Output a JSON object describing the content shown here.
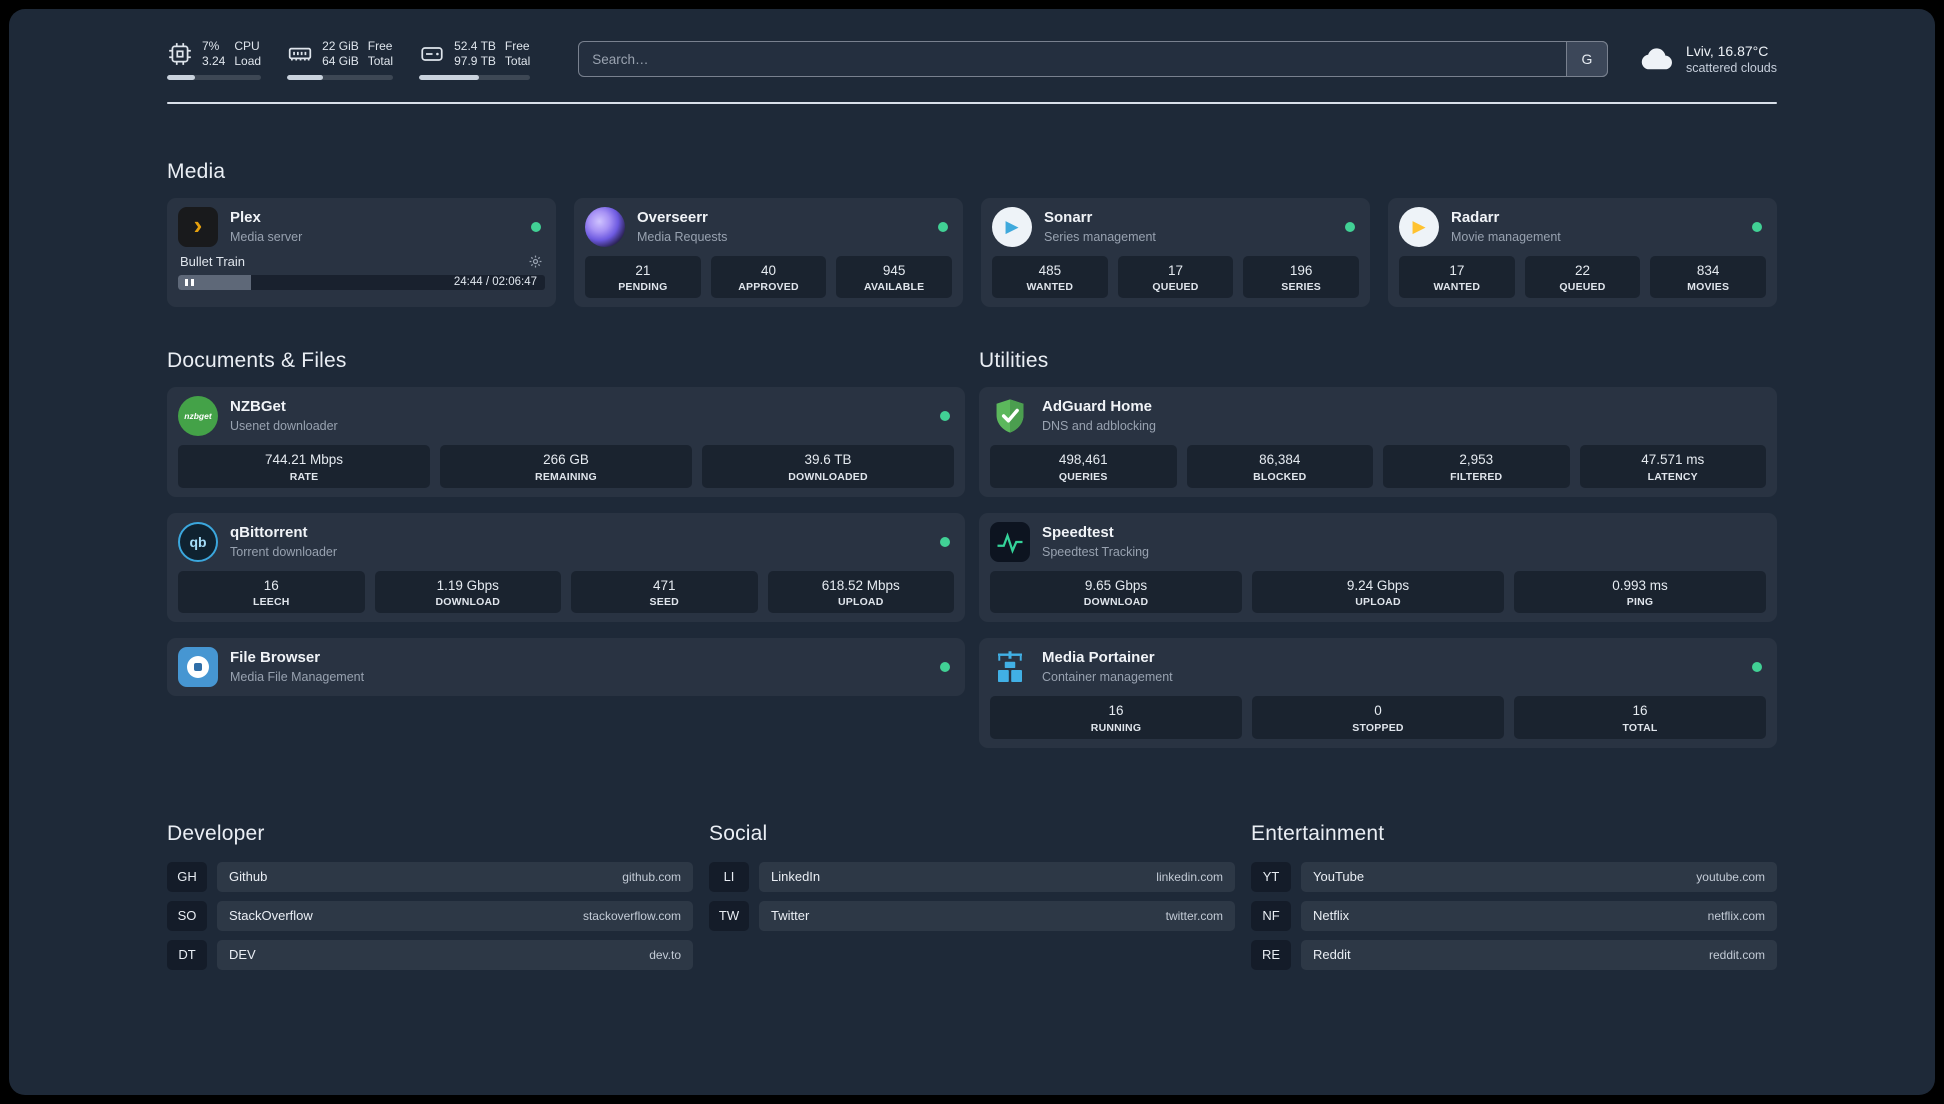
{
  "topbar": {
    "resources": [
      {
        "id": "cpu",
        "value_top": "7%",
        "value_bottom": "3.24",
        "label_top": "CPU",
        "label_bottom": "Load",
        "progress": 30
      },
      {
        "id": "memory",
        "value_top": "22 GiB",
        "value_bottom": "64 GiB",
        "label_top": "Free",
        "label_bottom": "Total",
        "progress": 34
      },
      {
        "id": "disk",
        "value_top": "52.4 TB",
        "value_bottom": "97.9 TB",
        "label_top": "Free",
        "label_bottom": "Total",
        "progress": 54
      }
    ],
    "search": {
      "placeholder": "Search…",
      "provider_label": "G"
    },
    "weather": {
      "location": "Lviv, 16.87°C",
      "condition": "scattered clouds"
    }
  },
  "sections": {
    "media": "Media",
    "documents": "Documents & Files",
    "utilities": "Utilities"
  },
  "icons": {
    "plex_glyph": "›",
    "sonarr_glyph": "▶",
    "radarr_glyph": "▶",
    "nzbget_text": "nzbget",
    "qbittorrent_text": "qb"
  },
  "colors": {
    "status_online": "#41d195",
    "plex": "#e5a00d",
    "overseerr": "#6d5ae0",
    "sonarr": "#3fa9dc",
    "radarr": "#ffc230",
    "nzbget": "#44a248",
    "qbittorrent": "#3ba7dd",
    "filebrowser": "#4696d2",
    "adguard": "#5cb85c",
    "speedtest": "#34d399",
    "portainer": "#41b0e5"
  },
  "services": {
    "plex": {
      "name": "Plex",
      "description": "Media server",
      "status": "online",
      "player": {
        "title": "Bullet Train",
        "time": "24:44 / 02:06:47",
        "progress": 20
      }
    },
    "overseerr": {
      "name": "Overseerr",
      "description": "Media Requests",
      "status": "online",
      "stats": [
        {
          "value": "21",
          "label": "PENDING"
        },
        {
          "value": "40",
          "label": "APPROVED"
        },
        {
          "value": "945",
          "label": "AVAILABLE"
        }
      ]
    },
    "sonarr": {
      "name": "Sonarr",
      "description": "Series management",
      "status": "online",
      "stats": [
        {
          "value": "485",
          "label": "WANTED"
        },
        {
          "value": "17",
          "label": "QUEUED"
        },
        {
          "value": "196",
          "label": "SERIES"
        }
      ]
    },
    "radarr": {
      "name": "Radarr",
      "description": "Movie management",
      "status": "online",
      "stats": [
        {
          "value": "17",
          "label": "WANTED"
        },
        {
          "value": "22",
          "label": "QUEUED"
        },
        {
          "value": "834",
          "label": "MOVIES"
        }
      ]
    },
    "nzbget": {
      "name": "NZBGet",
      "description": "Usenet downloader",
      "status": "online",
      "stats": [
        {
          "value": "744.21 Mbps",
          "label": "RATE"
        },
        {
          "value": "266 GB",
          "label": "REMAINING"
        },
        {
          "value": "39.6 TB",
          "label": "DOWNLOADED"
        }
      ]
    },
    "qbittorrent": {
      "name": "qBittorrent",
      "description": "Torrent downloader",
      "status": "online",
      "stats": [
        {
          "value": "16",
          "label": "LEECH"
        },
        {
          "value": "1.19 Gbps",
          "label": "DOWNLOAD"
        },
        {
          "value": "471",
          "label": "SEED"
        },
        {
          "value": "618.52 Mbps",
          "label": "UPLOAD"
        }
      ]
    },
    "filebrowser": {
      "name": "File Browser",
      "description": "Media File Management",
      "status": "online"
    },
    "adguard": {
      "name": "AdGuard Home",
      "description": "DNS and adblocking",
      "stats": [
        {
          "value": "498,461",
          "label": "QUERIES"
        },
        {
          "value": "86,384",
          "label": "BLOCKED"
        },
        {
          "value": "2,953",
          "label": "FILTERED"
        },
        {
          "value": "47.571 ms",
          "label": "LATENCY"
        }
      ]
    },
    "speedtest": {
      "name": "Speedtest",
      "description": "Speedtest Tracking",
      "stats": [
        {
          "value": "9.65 Gbps",
          "label": "DOWNLOAD"
        },
        {
          "value": "9.24 Gbps",
          "label": "UPLOAD"
        },
        {
          "value": "0.993 ms",
          "label": "PING"
        }
      ]
    },
    "portainer": {
      "name": "Media Portainer",
      "description": "Container management",
      "status": "online",
      "stats": [
        {
          "value": "16",
          "label": "RUNNING"
        },
        {
          "value": "0",
          "label": "STOPPED"
        },
        {
          "value": "16",
          "label": "TOTAL"
        }
      ]
    }
  },
  "bookmarks": {
    "developer": {
      "title": "Developer",
      "items": [
        {
          "abbr": "GH",
          "name": "Github",
          "domain": "github.com"
        },
        {
          "abbr": "SO",
          "name": "StackOverflow",
          "domain": "stackoverflow.com"
        },
        {
          "abbr": "DT",
          "name": "DEV",
          "domain": "dev.to"
        }
      ]
    },
    "social": {
      "title": "Social",
      "items": [
        {
          "abbr": "LI",
          "name": "LinkedIn",
          "domain": "linkedin.com"
        },
        {
          "abbr": "TW",
          "name": "Twitter",
          "domain": "twitter.com"
        }
      ]
    },
    "entertainment": {
      "title": "Entertainment",
      "items": [
        {
          "abbr": "YT",
          "name": "YouTube",
          "domain": "youtube.com"
        },
        {
          "abbr": "NF",
          "name": "Netflix",
          "domain": "netflix.com"
        },
        {
          "abbr": "RE",
          "name": "Reddit",
          "domain": "reddit.com"
        }
      ]
    }
  }
}
